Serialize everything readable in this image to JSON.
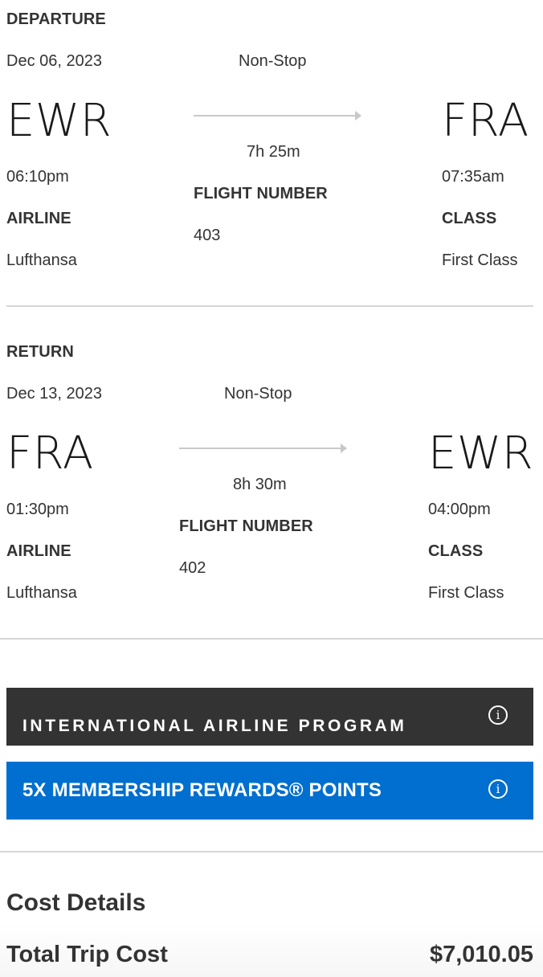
{
  "departure": {
    "heading": "DEPARTURE",
    "date": "Dec 06, 2023",
    "stops": "Non-Stop",
    "origin_code": "EWR",
    "dest_code": "FRA",
    "duration": "7h 25m",
    "depart_time": "06:10pm",
    "arrive_time": "07:35am",
    "flight_number_label": "FLIGHT NUMBER",
    "flight_number": "403",
    "airline_label": "AIRLINE",
    "airline": "Lufthansa",
    "class_label": "CLASS",
    "class": "First Class"
  },
  "return": {
    "heading": "RETURN",
    "date": "Dec 13, 2023",
    "stops": "Non-Stop",
    "origin_code": "FRA",
    "dest_code": "EWR",
    "duration": "8h 30m",
    "depart_time": "01:30pm",
    "arrive_time": "04:00pm",
    "flight_number_label": "FLIGHT NUMBER",
    "flight_number": "402",
    "airline_label": "AIRLINE",
    "airline": "Lufthansa",
    "class_label": "CLASS",
    "class": "First Class"
  },
  "banners": {
    "program": "INTERNATIONAL AIRLINE PROGRAM",
    "rewards": "5X MEMBERSHIP REWARDS® POINTS",
    "info_icon": "info-icon"
  },
  "cost": {
    "title": "Cost Details",
    "total_label": "Total Trip Cost",
    "total_value": "$7,010.05"
  },
  "colors": {
    "dark_banner": "#333333",
    "blue_banner": "#006fcf",
    "divider": "#d6d6d6",
    "text": "#333333"
  }
}
